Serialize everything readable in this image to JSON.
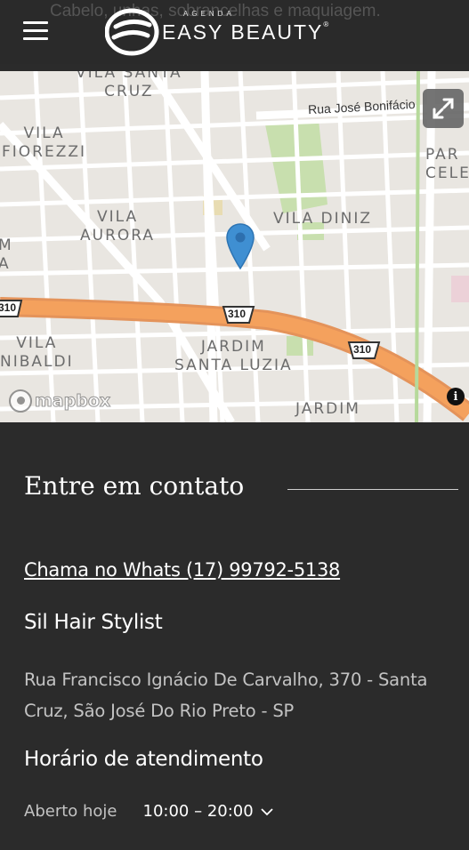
{
  "header": {
    "behind_text": "Cabelo, unhas, sobrancelhas e maquiagem.",
    "logo_top": "AGENDA",
    "logo_name": "EASY BEAUTY",
    "logo_mark": "®"
  },
  "map": {
    "labels": {
      "vila_santa_cruz": "VILA SANTA\nCRUZ",
      "vila_fiorezzi": "VILA\nFIOREZZI",
      "vila_aurora": "VILA\nAURORA",
      "vila_diniz": "VILA DINIZ",
      "parque_celeste": "PAR\nCELE",
      "vila_anibaldi": "VILA\nNIBALDI",
      "jardim_santa_luzia": "JARDIM\nSANTA LUZIA",
      "jardim": "JARDIM",
      "left_m": "M\nA"
    },
    "road_name": "Rua José Bonifácio",
    "highway_shield": "310",
    "attribution": "mapbox",
    "info_symbol": "i"
  },
  "contact": {
    "title": "Entre em contato",
    "whatsapp_link": "Chama no Whats (17) 99792-5138",
    "business_name": "Sil Hair Stylist",
    "address": "Rua Francisco Ignácio De Carvalho, 370 - Santa Cruz, São José Do Rio Preto - SP",
    "hours_title": "Horário de atendimento",
    "open_today": "Aberto hoje",
    "hours_value": "10:00 – 20:00"
  },
  "colors": {
    "background": "#2b2b2b",
    "highway": "#f4a15d",
    "pin": "#3f8fd2",
    "park": "#c8dfae"
  },
  "icons": [
    "menu-icon",
    "expand-icon",
    "map-pin-icon",
    "info-icon",
    "chevron-down-icon"
  ]
}
